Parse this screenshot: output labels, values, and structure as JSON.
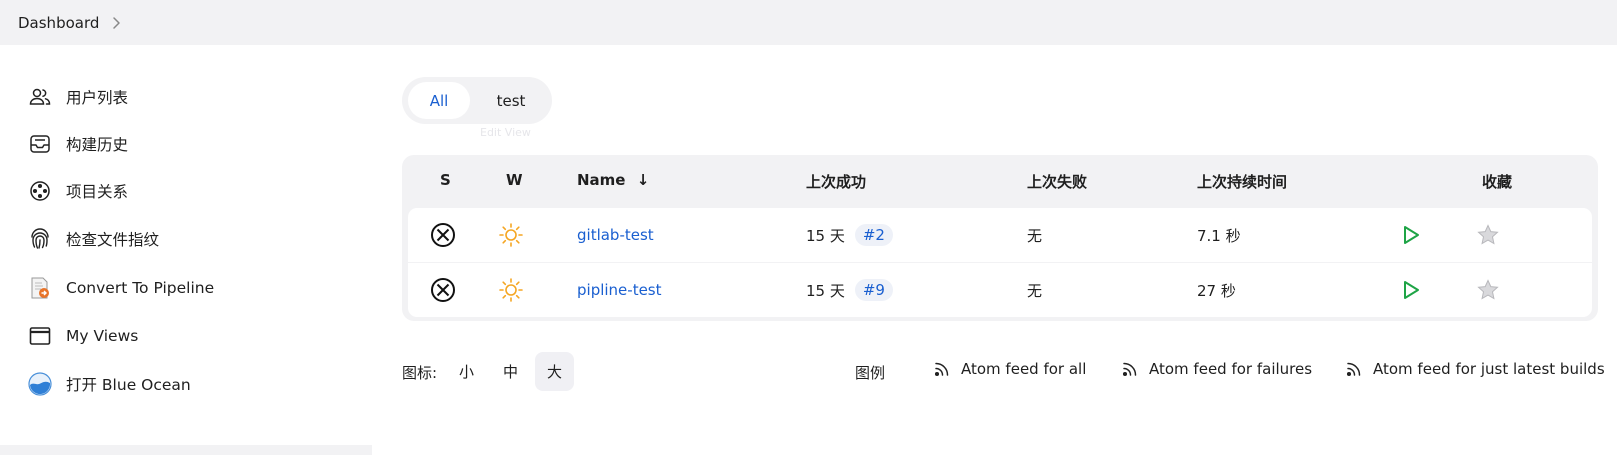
{
  "breadcrumb": {
    "items": [
      "Dashboard"
    ]
  },
  "sidebar": {
    "items": [
      {
        "label": "用户列表",
        "icon": "users-icon"
      },
      {
        "label": "构建历史",
        "icon": "inbox-icon"
      },
      {
        "label": "项目关系",
        "icon": "relationship-icon"
      },
      {
        "label": "检查文件指纹",
        "icon": "fingerprint-icon"
      },
      {
        "label": "Convert To Pipeline",
        "icon": "convert-document-icon"
      },
      {
        "label": "My Views",
        "icon": "window-icon"
      },
      {
        "label": "打开 Blue Ocean",
        "icon": "blue-ocean-icon"
      }
    ]
  },
  "views": {
    "tabs": [
      {
        "label": "All",
        "active": true
      },
      {
        "label": "test",
        "active": false
      }
    ],
    "ghost_label": "Edit View"
  },
  "table": {
    "headers": {
      "status": "S",
      "weather": "W",
      "name": "Name",
      "name_sort": "↓",
      "last_success": "上次成功",
      "last_failure": "上次失败",
      "last_duration": "上次持续时间",
      "favorite": "收藏"
    },
    "rows": [
      {
        "name": "gitlab-test",
        "last_success": "15 天",
        "build": "#2",
        "last_failure": "无",
        "duration": "7.1 秒",
        "status_icon": "failed-x-icon",
        "weather_icon": "sunny-icon"
      },
      {
        "name": "pipline-test",
        "last_success": "15 天",
        "build": "#9",
        "last_failure": "无",
        "duration": "27 秒",
        "status_icon": "failed-x-icon",
        "weather_icon": "sunny-icon"
      }
    ]
  },
  "footer": {
    "icon_label": "图标:",
    "sizes": [
      {
        "label": "小",
        "active": false
      },
      {
        "label": "中",
        "active": false
      },
      {
        "label": "大",
        "active": true
      }
    ],
    "legend": "图例",
    "feeds": [
      "Atom feed for all",
      "Atom feed for failures",
      "Atom feed for just latest builds"
    ]
  },
  "colors": {
    "accent": "#1a5fd0",
    "run_green": "#1ea446",
    "sun_orange": "#f5a623",
    "panel_bg": "#f2f2f4"
  }
}
